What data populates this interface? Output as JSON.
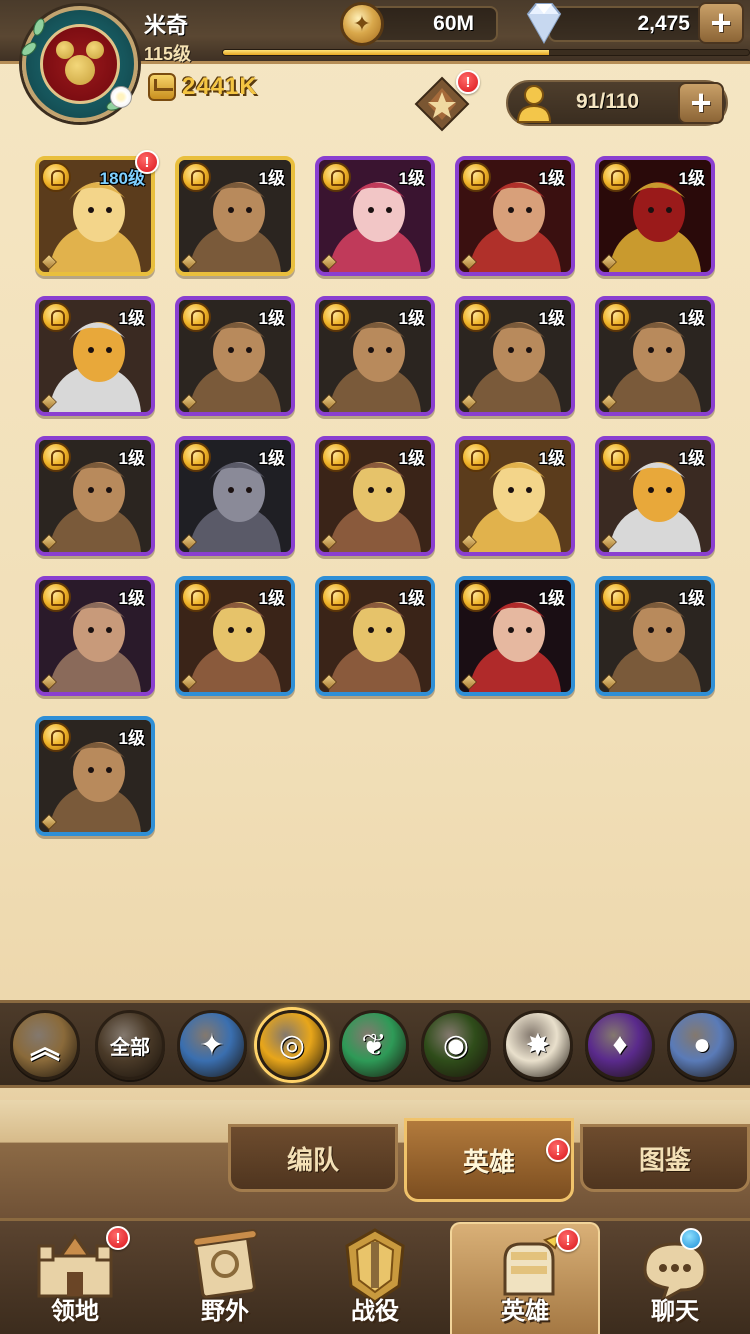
{
  "player": {
    "name": "米奇",
    "level": "115级",
    "xp_fraction": 0.62,
    "power": "2441K",
    "avatar_icon": "mouse-emblem-icon"
  },
  "currency": {
    "gold": "60M",
    "gems": "2,475"
  },
  "hero_capacity": "91/110",
  "formation_badge": "!",
  "heroes": [
    {
      "level": "180级",
      "rarity": "gold",
      "portrait": "lion-warrior",
      "badge": "!"
    },
    {
      "level": "1级",
      "rarity": "gold",
      "portrait": "hyena-rogue",
      "badge": ""
    },
    {
      "level": "1级",
      "rarity": "purple",
      "portrait": "cat-girl",
      "badge": ""
    },
    {
      "level": "1级",
      "rarity": "purple",
      "portrait": "red-beast",
      "badge": ""
    },
    {
      "level": "1级",
      "rarity": "purple",
      "portrait": "golden-mask",
      "badge": ""
    },
    {
      "level": "1级",
      "rarity": "purple",
      "portrait": "eagle-chief",
      "badge": ""
    },
    {
      "level": "1级",
      "rarity": "purple",
      "portrait": "hyena-rogue",
      "badge": ""
    },
    {
      "level": "1级",
      "rarity": "purple",
      "portrait": "hyena-rogue",
      "badge": ""
    },
    {
      "level": "1级",
      "rarity": "purple",
      "portrait": "hyena-rogue",
      "badge": ""
    },
    {
      "level": "1级",
      "rarity": "purple",
      "portrait": "hyena-rogue",
      "badge": ""
    },
    {
      "level": "1级",
      "rarity": "purple",
      "portrait": "hyena-rogue",
      "badge": ""
    },
    {
      "level": "1级",
      "rarity": "purple",
      "portrait": "wolf-knight",
      "badge": ""
    },
    {
      "level": "1级",
      "rarity": "purple",
      "portrait": "tribal-warrior",
      "badge": ""
    },
    {
      "level": "1级",
      "rarity": "purple",
      "portrait": "lion-warrior",
      "badge": ""
    },
    {
      "level": "1级",
      "rarity": "purple",
      "portrait": "eagle-chief",
      "badge": ""
    },
    {
      "level": "1级",
      "rarity": "purple",
      "portrait": "rat-thief",
      "badge": ""
    },
    {
      "level": "1级",
      "rarity": "blue",
      "portrait": "tribal-warrior",
      "badge": ""
    },
    {
      "level": "1级",
      "rarity": "blue",
      "portrait": "tribal-warrior",
      "badge": ""
    },
    {
      "level": "1级",
      "rarity": "blue",
      "portrait": "dark-sorceress",
      "badge": ""
    },
    {
      "level": "1级",
      "rarity": "blue",
      "portrait": "hyena-rogue",
      "badge": ""
    },
    {
      "level": "1级",
      "rarity": "blue",
      "portrait": "hyena-rogue",
      "badge": ""
    }
  ],
  "filters": [
    {
      "name": "collapse",
      "label": "",
      "icon": "double-chevron-up-icon",
      "color": "#8a6a3a"
    },
    {
      "name": "all",
      "label": "全部",
      "icon": "",
      "color": "#4a3a28"
    },
    {
      "name": "compass",
      "label": "",
      "icon": "compass-star-icon",
      "color": "#3a6fb0"
    },
    {
      "name": "lightbearer",
      "label": "",
      "icon": "sun-shield-icon",
      "color": "#e8a61a"
    },
    {
      "name": "wilder",
      "label": "",
      "icon": "leaf-icon",
      "color": "#2e9a57"
    },
    {
      "name": "graveborn",
      "label": "",
      "icon": "green-eye-icon",
      "color": "#2f4d1a"
    },
    {
      "name": "celestial",
      "label": "",
      "icon": "white-star-icon",
      "color": "#e9e0cc"
    },
    {
      "name": "hypogean",
      "label": "",
      "icon": "purple-demon-icon",
      "color": "#5a2a8c"
    },
    {
      "name": "dimensional",
      "label": "",
      "icon": "blue-orb-icon",
      "color": "#5a7bb8"
    }
  ],
  "selected_filter": "lightbearer",
  "subtabs": [
    {
      "label": "编队",
      "active": false
    },
    {
      "label": "英雄",
      "active": true,
      "badge": "!"
    },
    {
      "label": "图鉴",
      "active": false
    }
  ],
  "nav": [
    {
      "label": "领地",
      "icon": "castle-icon",
      "badge": "!",
      "active": false
    },
    {
      "label": "野外",
      "icon": "scroll-map-icon",
      "badge": "",
      "active": false
    },
    {
      "label": "战役",
      "icon": "battle-crest-icon",
      "badge": "",
      "active": false
    },
    {
      "label": "英雄",
      "icon": "gauntlet-icon",
      "badge": "!",
      "active": true
    },
    {
      "label": "聊天",
      "icon": "chat-bubble-icon",
      "badge": "blue",
      "active": false
    }
  ]
}
